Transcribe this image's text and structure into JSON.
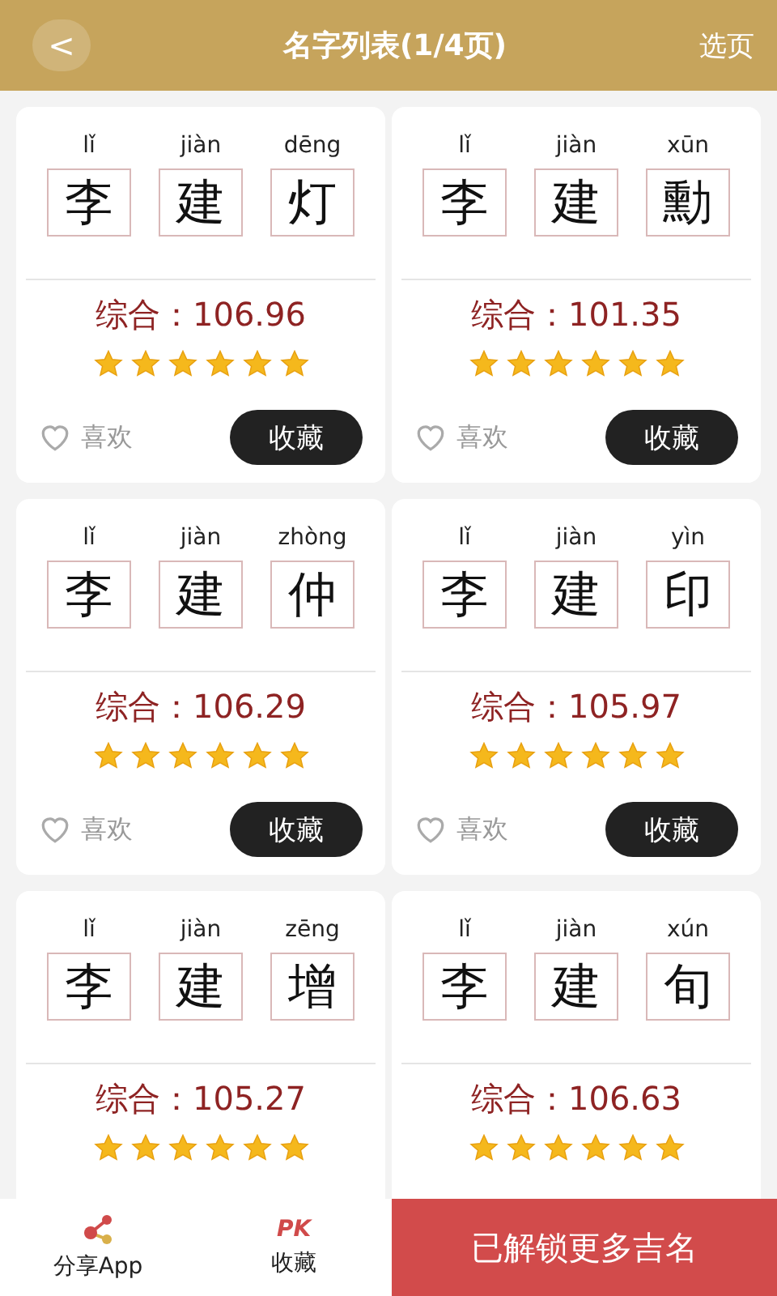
{
  "header": {
    "back": "<",
    "title": "名字列表(1/4页)",
    "action": "选页"
  },
  "cards": [
    {
      "chars": [
        {
          "pinyin": "lǐ",
          "char": "李"
        },
        {
          "pinyin": "jiàn",
          "char": "建"
        },
        {
          "pinyin": "dēng",
          "char": "灯"
        }
      ],
      "score": "综合：106.96",
      "stars": 6,
      "like": {
        "label": "喜欢",
        "liked": false
      },
      "collect": "收藏"
    },
    {
      "chars": [
        {
          "pinyin": "lǐ",
          "char": "李"
        },
        {
          "pinyin": "jiàn",
          "char": "建"
        },
        {
          "pinyin": "xūn",
          "char": "勳"
        }
      ],
      "score": "综合：101.35",
      "stars": 6,
      "like": {
        "label": "喜欢",
        "liked": false
      },
      "collect": "收藏"
    },
    {
      "chars": [
        {
          "pinyin": "lǐ",
          "char": "李"
        },
        {
          "pinyin": "jiàn",
          "char": "建"
        },
        {
          "pinyin": "zhòng",
          "char": "仲"
        }
      ],
      "score": "综合：106.29",
      "stars": 6,
      "like": {
        "label": "喜欢",
        "liked": false
      },
      "collect": "收藏"
    },
    {
      "chars": [
        {
          "pinyin": "lǐ",
          "char": "李"
        },
        {
          "pinyin": "jiàn",
          "char": "建"
        },
        {
          "pinyin": "yìn",
          "char": "印"
        }
      ],
      "score": "综合：105.97",
      "stars": 6,
      "like": {
        "label": "喜欢",
        "liked": false
      },
      "collect": "收藏"
    },
    {
      "chars": [
        {
          "pinyin": "lǐ",
          "char": "李"
        },
        {
          "pinyin": "jiàn",
          "char": "建"
        },
        {
          "pinyin": "zēng",
          "char": "增"
        }
      ],
      "score": "综合：105.27",
      "stars": 6
    },
    {
      "chars": [
        {
          "pinyin": "lǐ",
          "char": "李"
        },
        {
          "pinyin": "jiàn",
          "char": "建"
        },
        {
          "pinyin": "xún",
          "char": "旬"
        }
      ],
      "score": "综合：106.63",
      "stars": 6
    }
  ],
  "bottom_bar": {
    "share": "分享App",
    "pk_logo": "PK",
    "pk_label": "收藏",
    "unlock": "已解锁更多吉名"
  }
}
